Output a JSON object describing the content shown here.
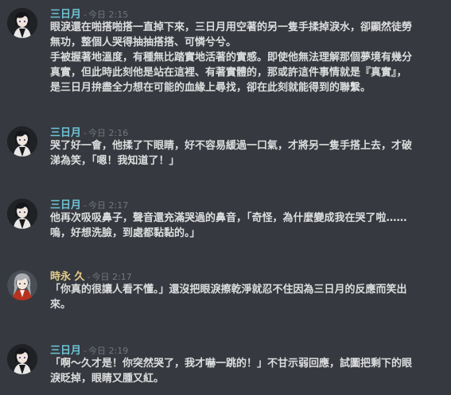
{
  "messages": [
    {
      "author": "三日月",
      "author_color": "#6ec3d6",
      "separator": "-",
      "timestamp": "今日 2:15",
      "avatar_icon": "dark-haired-character-avatar",
      "lines": [
        "眼淚還在啪搭啪搭一直掉下來，三日月用空著的另一隻手揉掉淚水，卻顯然徒勞\n無功，整個人哭得抽抽搭搭、可憐兮兮。",
        "手被握著地溫度，有種無比踏實地活著的實感。即使他無法理解那個夢境有幾分\n真實，但此時此刻他是站在這裡、有著實體的，那或許這件事情就是『真實』，\n是三日月拚盡全力想在可能的血緣上尋找，卻在此刻就能得到的聯繫。"
      ]
    },
    {
      "author": "三日月",
      "author_color": "#6ec3d6",
      "separator": "-",
      "timestamp": "今日 2:16",
      "avatar_icon": "dark-haired-character-avatar",
      "lines": [
        "哭了好一會，他揉了下眼睛，好不容易緩過一口氣，才將另一隻手搭上去，才破\n涕為笑，「嗯！我知道了！」"
      ]
    },
    {
      "author": "三日月",
      "author_color": "#6ec3d6",
      "separator": "-",
      "timestamp": "今日 2:17",
      "avatar_icon": "dark-haired-character-avatar",
      "lines": [
        "他再次吸吸鼻子，聲音還充滿哭過的鼻音，「奇怪，為什麼變成我在哭了啦……\n嗚，好想洗臉，到處都黏黏的。」"
      ]
    },
    {
      "author": "時永 久",
      "author_color": "#e3cc8a",
      "separator": "-",
      "timestamp": "今日 2:17",
      "avatar_icon": "gray-haired-character-avatar",
      "lines": [
        "「你真的很讓人看不懂。」還沒把眼淚擦乾淨就忍不住因為三日月的反應而笑出\n來。"
      ]
    },
    {
      "author": "三日月",
      "author_color": "#6ec3d6",
      "separator": "-",
      "timestamp": "今日 2:19",
      "avatar_icon": "dark-haired-character-avatar",
      "lines": [
        "「啊〜久才是！你突然哭了，我才嚇一跳的！」不甘示弱回應，試圖把剩下的眼\n淚眨掉，眼睛又腫又紅。"
      ]
    }
  ]
}
